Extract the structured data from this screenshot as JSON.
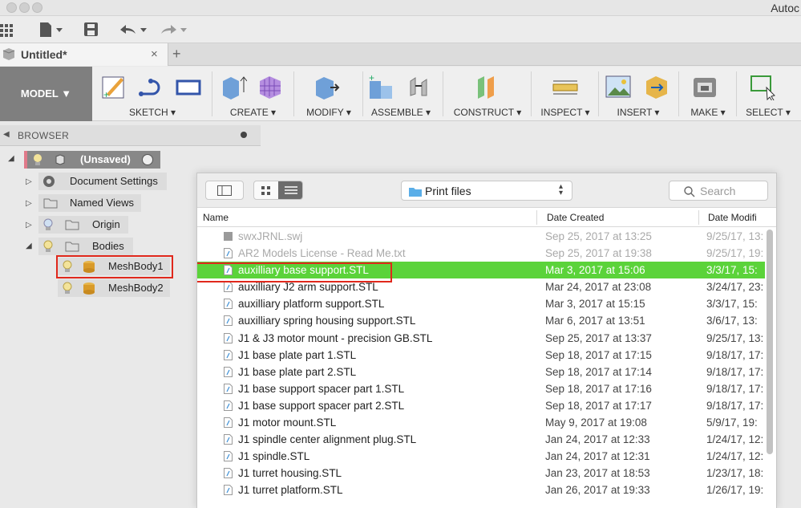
{
  "app": {
    "title": "Autoc"
  },
  "document_tab": {
    "name": "Untitled*",
    "close": "×",
    "add": "+"
  },
  "ribbon": {
    "workspace": "MODEL ▼",
    "groups": [
      {
        "label": "SKETCH ▾"
      },
      {
        "label": "CREATE ▾"
      },
      {
        "label": "MODIFY ▾"
      },
      {
        "label": "ASSEMBLE ▾"
      },
      {
        "label": "CONSTRUCT ▾"
      },
      {
        "label": "INSPECT ▾"
      },
      {
        "label": "INSERT ▾"
      },
      {
        "label": "MAKE ▾"
      },
      {
        "label": "SELECT ▾"
      }
    ]
  },
  "browser": {
    "title": "BROWSER",
    "root": "(Unsaved)",
    "items": [
      {
        "label": "Document Settings",
        "icon": "gear-icon"
      },
      {
        "label": "Named Views",
        "icon": "folder-icon"
      },
      {
        "label": "Origin",
        "icon": "folder-icon"
      },
      {
        "label": "Bodies",
        "icon": "folder-icon"
      },
      {
        "label": "MeshBody1",
        "icon": "mesh-body-icon"
      },
      {
        "label": "MeshBody2",
        "icon": "mesh-body-icon"
      }
    ]
  },
  "dialog": {
    "location": "Print files",
    "search_placeholder": "Search",
    "columns": {
      "name": "Name",
      "created": "Date Created",
      "modified": "Date Modifi"
    },
    "files": [
      {
        "name": "swxJRNL.swj",
        "created": "Sep 25, 2017 at 13:25",
        "modified": "9/25/17, 13:",
        "state": "dim",
        "icon": "generic-file-icon"
      },
      {
        "name": "AR2 Models License - Read Me.txt",
        "created": "Sep 25, 2017 at 19:38",
        "modified": "9/25/17, 19:",
        "state": "dim",
        "icon": "text-file-icon"
      },
      {
        "name": "auxilliary base support.STL",
        "created": "Mar 3, 2017 at 15:06",
        "modified": "3/3/17, 15:",
        "state": "selected",
        "icon": "stl-file-icon"
      },
      {
        "name": "auxilliary J2 arm support.STL",
        "created": "Mar 24, 2017 at 23:08",
        "modified": "3/24/17, 23:",
        "state": "normal",
        "icon": "stl-file-icon"
      },
      {
        "name": "auxilliary platform support.STL",
        "created": "Mar 3, 2017 at 15:15",
        "modified": "3/3/17, 15:",
        "state": "normal",
        "icon": "stl-file-icon"
      },
      {
        "name": "auxilliary spring housing support.STL",
        "created": "Mar 6, 2017 at 13:51",
        "modified": "3/6/17, 13:",
        "state": "normal",
        "icon": "stl-file-icon"
      },
      {
        "name": "J1 & J3 motor mount - precision GB.STL",
        "created": "Sep 25, 2017 at 13:37",
        "modified": "9/25/17, 13:",
        "state": "normal",
        "icon": "stl-file-icon"
      },
      {
        "name": "J1 base plate part 1.STL",
        "created": "Sep 18, 2017 at 17:15",
        "modified": "9/18/17, 17:",
        "state": "normal",
        "icon": "stl-file-icon"
      },
      {
        "name": "J1 base plate part 2.STL",
        "created": "Sep 18, 2017 at 17:14",
        "modified": "9/18/17, 17:",
        "state": "normal",
        "icon": "stl-file-icon"
      },
      {
        "name": "J1 base support spacer part 1.STL",
        "created": "Sep 18, 2017 at 17:16",
        "modified": "9/18/17, 17:",
        "state": "normal",
        "icon": "stl-file-icon"
      },
      {
        "name": "J1 base support spacer part 2.STL",
        "created": "Sep 18, 2017 at 17:17",
        "modified": "9/18/17, 17:",
        "state": "normal",
        "icon": "stl-file-icon"
      },
      {
        "name": "J1 motor mount.STL",
        "created": "May 9, 2017 at 19:08",
        "modified": "5/9/17, 19:",
        "state": "normal",
        "icon": "stl-file-icon"
      },
      {
        "name": "J1 spindle center alignment plug.STL",
        "created": "Jan 24, 2017 at 12:33",
        "modified": "1/24/17, 12:",
        "state": "normal",
        "icon": "stl-file-icon"
      },
      {
        "name": "J1 spindle.STL",
        "created": "Jan 24, 2017 at 12:31",
        "modified": "1/24/17, 12:",
        "state": "normal",
        "icon": "stl-file-icon"
      },
      {
        "name": "J1 turret housing.STL",
        "created": "Jan 23, 2017 at 18:53",
        "modified": "1/23/17, 18:",
        "state": "normal",
        "icon": "stl-file-icon"
      },
      {
        "name": "J1 turret platform.STL",
        "created": "Jan 26, 2017 at 19:33",
        "modified": "1/26/17, 19:",
        "state": "normal",
        "icon": "stl-file-icon"
      }
    ]
  },
  "colors": {
    "selected_row": "#5bd33a",
    "highlight_box": "#e0281c",
    "model_button": "#7f7f7f"
  }
}
